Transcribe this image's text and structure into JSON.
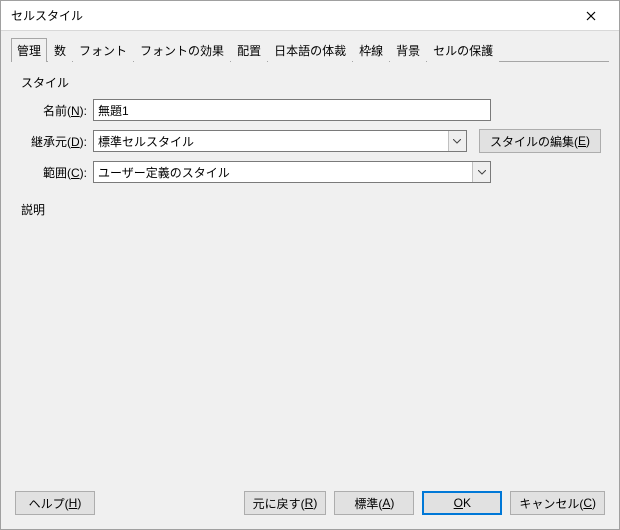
{
  "titlebar": {
    "title": "セルスタイル"
  },
  "tabs": [
    {
      "label": "管理"
    },
    {
      "label": "数"
    },
    {
      "label": "フォント"
    },
    {
      "label": "フォントの効果"
    },
    {
      "label": "配置"
    },
    {
      "label": "日本語の体裁"
    },
    {
      "label": "枠線"
    },
    {
      "label": "背景"
    },
    {
      "label": "セルの保護"
    }
  ],
  "section_style": "スタイル",
  "labels": {
    "name_pre": "名前(",
    "name_u": "N",
    "name_post": "):",
    "inherit_pre": "継承元(",
    "inherit_u": "D",
    "inherit_post": "):",
    "category_pre": "範囲(",
    "category_u": "C",
    "category_post": "):"
  },
  "values": {
    "name": "無題1",
    "inherit": "標準セルスタイル",
    "category": "ユーザー定義のスタイル"
  },
  "edit_style": {
    "pre": "スタイルの編集(",
    "u": "E",
    "post": ")"
  },
  "desc": "説明",
  "footer": {
    "help": {
      "pre": "ヘルプ(",
      "u": "H",
      "post": ")"
    },
    "reset": {
      "pre": "元に戻す(",
      "u": "R",
      "post": ")"
    },
    "standard": {
      "pre": "標準(",
      "u": "A",
      "post": ")"
    },
    "ok": {
      "u": "O",
      "post": "K"
    },
    "cancel": {
      "pre": "キャンセル(",
      "u": "C",
      "post": ")"
    }
  }
}
